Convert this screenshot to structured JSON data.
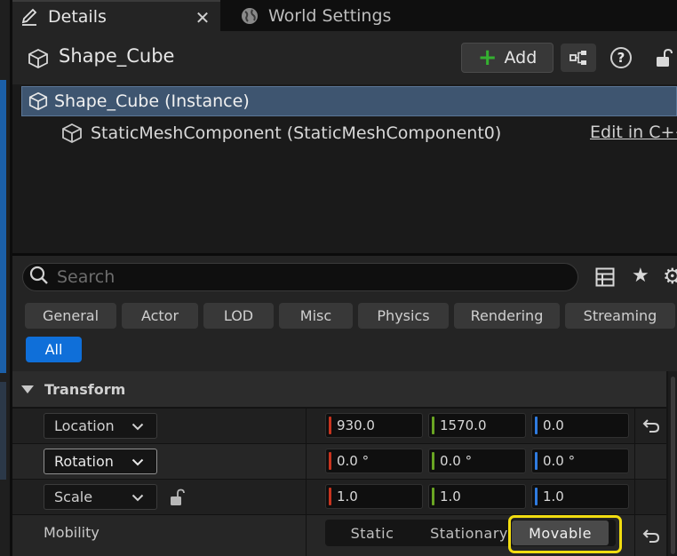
{
  "tabs": [
    {
      "label": "Details",
      "icon": "pencil-icon",
      "active": true
    },
    {
      "label": "World Settings",
      "icon": "globe-icon",
      "active": false
    }
  ],
  "header": {
    "actor_name": "Shape_Cube",
    "add_label": "Add"
  },
  "tree": {
    "instance_label": "Shape_Cube (Instance)",
    "component_label": "StaticMeshComponent (StaticMeshComponent0)",
    "edit_link": "Edit in C++"
  },
  "search": {
    "placeholder": "Search"
  },
  "filters": [
    "General",
    "Actor",
    "LOD",
    "Misc",
    "Physics",
    "Rendering",
    "Streaming",
    "All"
  ],
  "active_filter": "All",
  "transform": {
    "section_label": "Transform",
    "location": {
      "label": "Location",
      "x": "930.0",
      "y": "1570.0",
      "z": "0.0"
    },
    "rotation": {
      "label": "Rotation",
      "x": "0.0 °",
      "y": "0.0 °",
      "z": "0.0 °"
    },
    "scale": {
      "label": "Scale",
      "x": "1.0",
      "y": "1.0",
      "z": "1.0"
    },
    "mobility": {
      "label": "Mobility",
      "options": [
        "Static",
        "Stationary",
        "Movable"
      ],
      "selected": "Movable"
    }
  },
  "colors": {
    "x_axis": "#c8341f",
    "y_axis": "#6aa523",
    "z_axis": "#2f7be0",
    "accent": "#0f6fd9",
    "highlight": "#f2dd10"
  }
}
